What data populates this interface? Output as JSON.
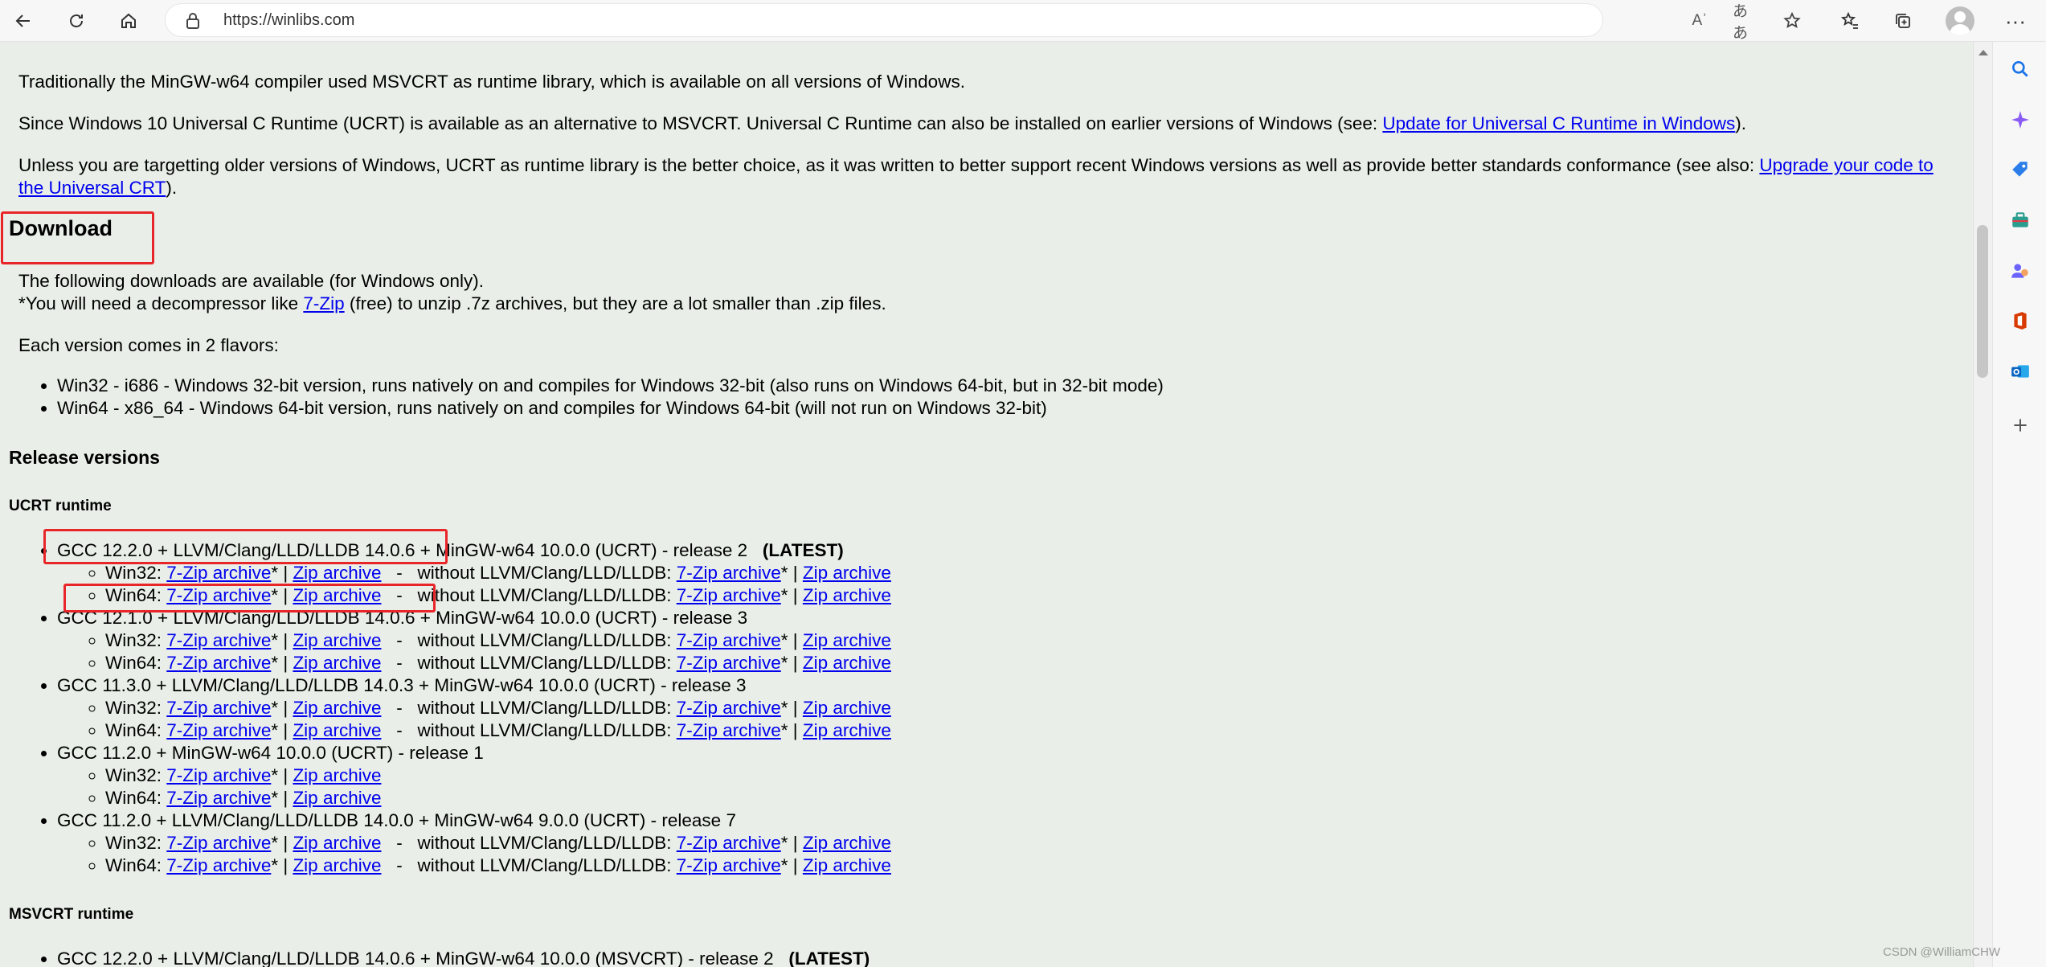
{
  "browser": {
    "url": "https://winlibs.com",
    "toolbar_icons": [
      "back-icon",
      "refresh-icon",
      "home-icon",
      "lock-icon",
      "read-aloud-icon",
      "translate-icon",
      "add-favorite-icon",
      "favorites-icon",
      "collections-icon",
      "profile-avatar",
      "more-icon"
    ],
    "read_aloud_glyph": "Aʾ",
    "translate_glyph": "ああ",
    "more_glyph": "···"
  },
  "content": {
    "msvcrt_para": "Traditionally the MinGW-w64 compiler used MSVCRT as runtime library, which is available on all versions of Windows.",
    "ucrt_para_pre": "Since Windows 10 Universal C Runtime (UCRT) is available as an alternative to MSVCRT. Universal C Runtime can also be installed on earlier versions of Windows (see: ",
    "ucrt_link": "Update for Universal C Runtime in Windows",
    "ucrt_para_post": ").",
    "target_para_pre": "Unless you are targetting older versions of Windows, UCRT as runtime library is the better choice, as it was written to better support recent Windows versions as well as provide better standards conformance (see also: ",
    "target_link": "Upgrade your code to the Universal CRT",
    "target_para_post": ").",
    "download_heading": "Download",
    "downloads_line": "The following downloads are available (for Windows only).",
    "decompressor_pre": "*You will need a decompressor like ",
    "decompressor_link": "7-Zip",
    "decompressor_post": " (free) to unzip .7z archives, but they are a lot smaller than .zip files.",
    "flavors_line": "Each version comes in 2 flavors:",
    "flavors": [
      "Win32 - i686 - Windows 32-bit version, runs natively on and compiles for Windows 32-bit (also runs on Windows 64-bit, but in 32-bit mode)",
      "Win64 - x86_64 - Windows 64-bit version, runs natively on and compiles for Windows 64-bit (will not run on Windows 32-bit)"
    ],
    "release_heading": "Release versions",
    "ucrt_heading": "UCRT runtime",
    "msvcrt_heading": "MSVCRT runtime",
    "labels": {
      "zip7": "7-Zip archive",
      "zip": "Zip archive",
      "without": "without LLVM/Clang/LLD/LLDB: ",
      "win32": "Win32: ",
      "win64": "Win64: ",
      "star_sep": "* | ",
      "dash": "   -   ",
      "star_end": "*"
    },
    "releases": [
      {
        "title": "GCC 12.2.0 + LLVM/Clang/LLD/LLDB 14.0.6 + MinGW-w64 10.0.0 (UCRT) - release 2",
        "latest": "(LATEST)",
        "without": true
      },
      {
        "title": "GCC 12.1.0 + LLVM/Clang/LLD/LLDB 14.0.6 + MinGW-w64 10.0.0 (UCRT) - release 3",
        "latest": "",
        "without": true
      },
      {
        "title": "GCC 11.3.0 + LLVM/Clang/LLD/LLDB 14.0.3 + MinGW-w64 10.0.0 (UCRT) - release 3",
        "latest": "",
        "without": true
      },
      {
        "title": "GCC 11.2.0 + MinGW-w64 10.0.0 (UCRT) - release 1",
        "latest": "",
        "without": false
      },
      {
        "title": "GCC 11.2.0 + LLVM/Clang/LLD/LLDB 14.0.0 + MinGW-w64 9.0.0 (UCRT) - release 7",
        "latest": "",
        "without": true
      }
    ],
    "msvcrt_first": {
      "title": "GCC 12.2.0 + LLVM/Clang/LLD/LLDB 14.0.6 + MinGW-w64 10.0.0 (MSVCRT) - release 2",
      "latest": "(LATEST)"
    }
  },
  "sidebar_icons": [
    "search-icon",
    "copilot-icon",
    "shopping-icon",
    "tools-icon",
    "games-icon",
    "office-icon",
    "outlook-icon",
    "add-icon"
  ],
  "watermark": "CSDN @WilliamCHW",
  "colors": {
    "page_bg": "#e9efe8",
    "link": "#0000ee",
    "highlight_box": "#e8262a"
  }
}
